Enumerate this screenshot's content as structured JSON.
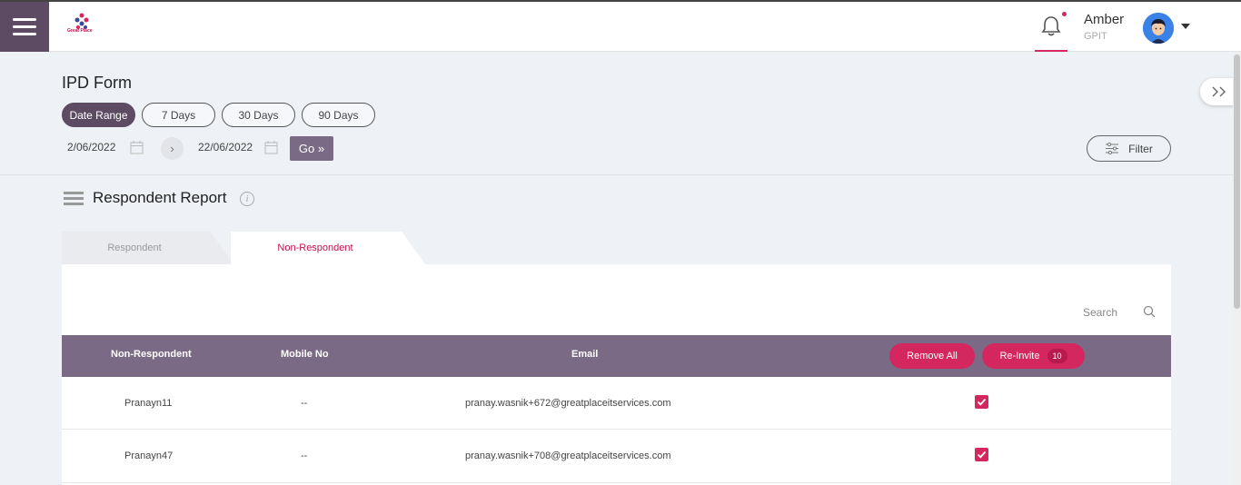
{
  "header": {
    "logo_text": "Great Place",
    "user_name": "Amber",
    "user_org": "GPIT",
    "accent_color": "#d4265f",
    "brand_color": "#5d4a63"
  },
  "page": {
    "title": "IPD Form",
    "ranges": [
      "Date Range",
      "7 Days",
      "30 Days",
      "90 Days"
    ],
    "active_range": "Date Range",
    "start_date": "2/06/2022",
    "end_date": "22/06/2022",
    "go_label": "Go »",
    "filter_label": "Filter"
  },
  "report": {
    "title": "Respondent Report",
    "tabs": [
      "Respondent",
      "Non-Respondent"
    ],
    "active_tab": "Non-Respondent",
    "search_placeholder": "Search",
    "columns": [
      "Non-Respondent",
      "Mobile No",
      "Email"
    ],
    "remove_all_label": "Remove All",
    "reinvite_label": "Re-Invite",
    "reinvite_count": "10",
    "rows": [
      {
        "name": "Pranayn11",
        "mobile": "--",
        "email": "pranay.wasnik+672@greatplaceitservices.com",
        "checked": true
      },
      {
        "name": "Pranayn47",
        "mobile": "--",
        "email": "pranay.wasnik+708@greatplaceitservices.com",
        "checked": true
      }
    ]
  }
}
